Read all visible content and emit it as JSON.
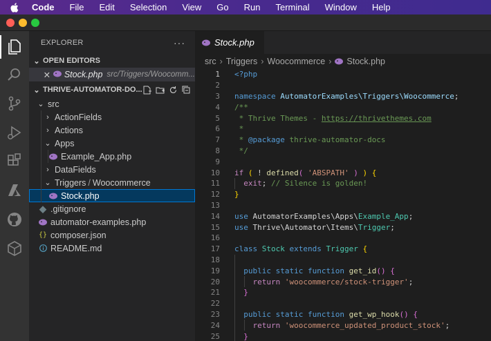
{
  "menubar": {
    "app": "Code",
    "items": [
      "File",
      "Edit",
      "Selection",
      "View",
      "Go",
      "Run",
      "Terminal",
      "Window",
      "Help"
    ]
  },
  "activitybar": {
    "icons": [
      "explorer-icon",
      "search-icon",
      "source-control-icon",
      "run-debug-icon",
      "extensions-icon",
      "azure-icon",
      "github-icon",
      "remote-explorer-icon"
    ]
  },
  "sidebar": {
    "title": "EXPLORER",
    "more": "···",
    "open_editors": {
      "title": "OPEN EDITORS",
      "items": [
        {
          "name": "Stock.php",
          "path": "src/Triggers/Woocomm..."
        }
      ]
    },
    "folder": {
      "title": "THRIVE-AUTOMATOR-DO...",
      "tree": [
        {
          "label": "src",
          "type": "folder-open"
        },
        {
          "label": "ActionFields",
          "type": "folder"
        },
        {
          "label": "Actions",
          "type": "folder"
        },
        {
          "label": "Apps",
          "type": "folder-open"
        },
        {
          "label": "Example_App.php",
          "type": "php"
        },
        {
          "label": "DataFields",
          "type": "folder"
        },
        {
          "label": "Triggers",
          "label2": "Woocommerce",
          "type": "folder-open"
        },
        {
          "label": "Stock.php",
          "type": "php"
        },
        {
          "label": ".gitignore",
          "type": "gitignore"
        },
        {
          "label": "automator-examples.php",
          "type": "php"
        },
        {
          "label": "composer.json",
          "type": "json"
        },
        {
          "label": "README.md",
          "type": "info"
        }
      ]
    }
  },
  "editor": {
    "tab": {
      "label": "Stock.php"
    },
    "breadcrumbs": [
      "src",
      "Triggers",
      "Woocommerce",
      "Stock.php"
    ],
    "line_numbers": [
      "1",
      "2",
      "3",
      "4",
      "5",
      "6",
      "7",
      "8",
      "9",
      "10",
      "11",
      "12",
      "13",
      "14",
      "15",
      "16",
      "17",
      "18",
      "19",
      "20",
      "21",
      "22",
      "23",
      "24",
      "25"
    ],
    "code": {
      "php_open": "<?php",
      "namespace_kw": "namespace",
      "namespace_name": "AutomatorExamples\\Triggers\\Woocommerce",
      "doc_open": "/**",
      "doc_line1": " * Thrive Themes - ",
      "doc_link": "https://thrivethemes.com",
      "doc_star": " *",
      "doc_package_key": "@package",
      "doc_package_val": " thrive-automator-docs",
      "doc_close": " */",
      "if_kw": "if",
      "defined_fn": "defined",
      "abspath_str": "'ABSPATH'",
      "exit_kw": "exit",
      "exit_comment": "// Silence is golden!",
      "use_kw": "use",
      "use1_ns": "AutomatorExamples\\Apps\\",
      "use1_cls": "Example_App",
      "use2_ns": "Thrive\\Automator\\Items\\",
      "use2_cls": "Trigger",
      "class_kw": "class",
      "class_name": "Stock",
      "extends_kw": "extends",
      "parent_cls": "Trigger",
      "public_kw": "public",
      "static_kw": "static",
      "function_kw": "function",
      "fn1_name": "get_id",
      "return_kw": "return",
      "fn1_str": "'woocommerce/stock-trigger'",
      "fn2_name": "get_wp_hook",
      "fn2_str": "'woocommerce_updated_product_stock'"
    }
  },
  "colors": {
    "menubar": "#4b2a8e",
    "activitybar": "#333333",
    "sidebar": "#252526",
    "editor": "#1e1e1e",
    "selection": "#04395e",
    "focus_border": "#0078d4"
  }
}
